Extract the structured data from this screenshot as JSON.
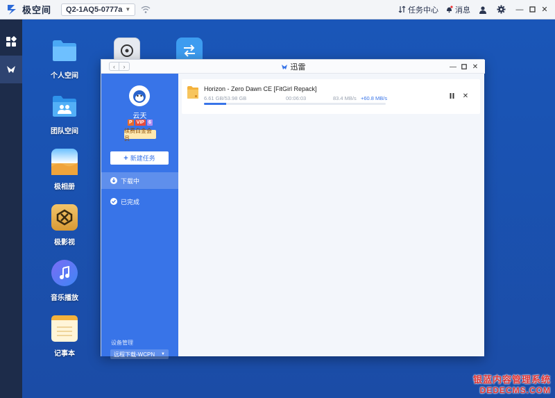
{
  "topbar": {
    "brand_name": "极空间",
    "device": "Q2-1AQ5-0777a",
    "task_center": "任务中心",
    "messages": "消息"
  },
  "desktop": {
    "icons": [
      {
        "label": "个人空间",
        "icon": "folder-icon"
      },
      {
        "label": "团队空间",
        "icon": "team-folder-icon"
      },
      {
        "label": "极相册",
        "icon": "photo-album-icon"
      },
      {
        "label": "极影视",
        "icon": "video-icon"
      },
      {
        "label": "音乐播放",
        "icon": "music-icon"
      },
      {
        "label": "记事本",
        "icon": "notepad-icon"
      }
    ]
  },
  "window": {
    "title": "迅雷",
    "sidebar": {
      "username": "云天",
      "vip_badges": [
        "P",
        "VIP",
        "6"
      ],
      "renew_label": "续费白金会员",
      "new_task_label": "新建任务",
      "nav": [
        {
          "label": "下载中",
          "active": true
        },
        {
          "label": "已完成",
          "active": false
        }
      ],
      "device_management_label": "设备管理",
      "device_select_value": "远程下载-WCPN"
    },
    "tasks": [
      {
        "name": "Horizon - Zero Dawn CE [FitGirl Repack]",
        "size_progress": "6.61 GB/53.98 GB",
        "remaining_time": "00:06:03",
        "speed": "83.4 MB/s",
        "boost_speed": "+60.8 MB/s",
        "progress_fraction": 0.122
      }
    ]
  },
  "watermark": {
    "line1": "银蓝内容管理系统",
    "line2": "DEDECMS.COM"
  },
  "colors": {
    "accent": "#3874e8",
    "desktop_bg": "#1a56b8",
    "dock_bg": "#1d2c4a"
  }
}
